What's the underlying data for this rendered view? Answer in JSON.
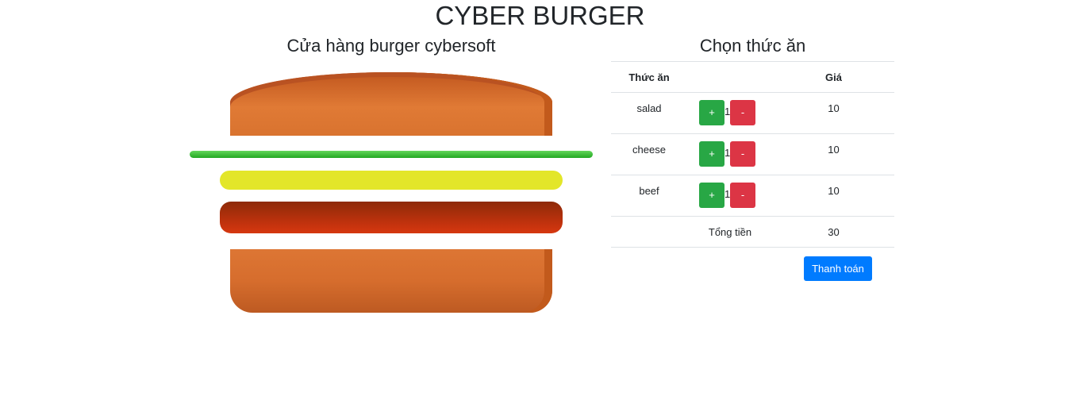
{
  "header": {
    "title": "CYBER BURGER"
  },
  "shop": {
    "title": "Cửa hàng burger cybersoft"
  },
  "menu": {
    "title": "Chọn thức ăn",
    "columns": {
      "food": "Thức ăn",
      "quantity": "",
      "price": "Giá"
    },
    "items": [
      {
        "name": "salad",
        "quantity": "1",
        "price": "10",
        "plus": "+",
        "minus": "-"
      },
      {
        "name": "cheese",
        "quantity": "1",
        "price": "10",
        "plus": "+",
        "minus": "-"
      },
      {
        "name": "beef",
        "quantity": "1",
        "price": "10",
        "plus": "+",
        "minus": "-"
      }
    ],
    "total_label": "Tổng tiền",
    "total_value": "30",
    "pay_label": "Thanh toán"
  },
  "colors": {
    "bread": "#e07a35",
    "salad": "#2cb52a",
    "cheese": "#e3e629",
    "beef": "#c6330e",
    "plus": "#28a745",
    "minus": "#dc3545",
    "pay": "#007bff"
  }
}
